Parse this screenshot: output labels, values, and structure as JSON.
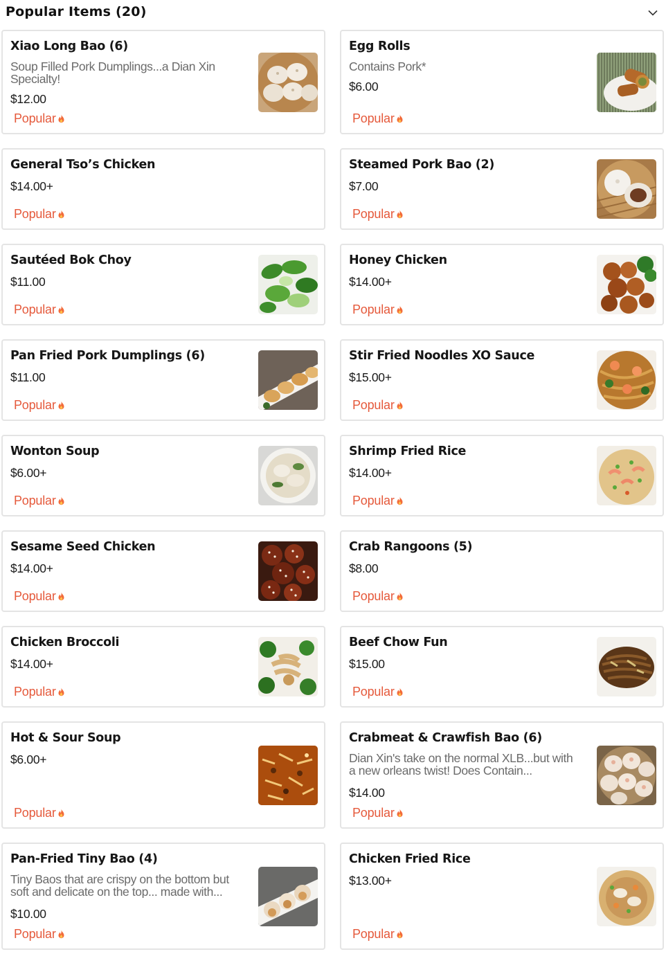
{
  "section": {
    "title": "Popular Items (20)"
  },
  "colors": {
    "popular": "#e5593b",
    "border": "#e4e4e4",
    "text": "#161616",
    "muted": "#6b6b6b"
  },
  "badge_label": "Popular",
  "items": [
    {
      "name": "Xiao Long Bao (6)",
      "description": "Soup Filled Pork Dumplings...a Dian Xin Specialty!",
      "price": "$12.00",
      "image": "soup-dumplings-photo"
    },
    {
      "name": "Egg Rolls",
      "description": "Contains Pork*",
      "price": "$6.00",
      "image": "egg-rolls-photo"
    },
    {
      "name": "General Tso’s Chicken",
      "description": "",
      "price": "$14.00+",
      "image": ""
    },
    {
      "name": "Steamed Pork Bao (2)",
      "description": "",
      "price": "$7.00",
      "image": "pork-bao-photo"
    },
    {
      "name": "Sautéed Bok Choy",
      "description": "",
      "price": "$11.00",
      "image": "bok-choy-photo"
    },
    {
      "name": "Honey Chicken",
      "description": "",
      "price": "$14.00+",
      "image": "honey-chicken-photo"
    },
    {
      "name": "Pan Fried Pork Dumplings (6)",
      "description": "",
      "price": "$11.00",
      "image": "pan-fried-dumplings-photo"
    },
    {
      "name": "Stir Fried Noodles XO Sauce",
      "description": "",
      "price": "$15.00+",
      "image": "xo-noodles-photo"
    },
    {
      "name": "Wonton Soup",
      "description": "",
      "price": "$6.00+",
      "image": "wonton-soup-photo"
    },
    {
      "name": "Shrimp Fried Rice",
      "description": "",
      "price": "$14.00+",
      "image": "shrimp-fried-rice-photo"
    },
    {
      "name": "Sesame Seed Chicken",
      "description": "",
      "price": "$14.00+",
      "image": "sesame-chicken-photo"
    },
    {
      "name": "Crab Rangoons (5)",
      "description": "",
      "price": "$8.00",
      "image": ""
    },
    {
      "name": "Chicken Broccoli",
      "description": "",
      "price": "$14.00+",
      "image": "chicken-broccoli-photo"
    },
    {
      "name": "Beef Chow Fun",
      "description": "",
      "price": "$15.00",
      "image": "beef-chow-fun-photo"
    },
    {
      "name": "Hot & Sour Soup",
      "description": "",
      "price": "$6.00+",
      "image": "hot-sour-soup-photo"
    },
    {
      "name": "Crabmeat & Crawfish Bao (6)",
      "description": "Dian Xin's take on the normal XLB...but with a new orleans twist! Does Contain...",
      "price": "$14.00",
      "image": "crawfish-bao-photo"
    },
    {
      "name": "Pan-Fried Tiny Bao (4)",
      "description": "Tiny Baos that are crispy on the bottom but soft and delicate on the top... made with...",
      "price": "$10.00",
      "image": "tiny-bao-photo"
    },
    {
      "name": "Chicken Fried Rice",
      "description": "",
      "price": "$13.00+",
      "image": "chicken-fried-rice-photo"
    }
  ]
}
